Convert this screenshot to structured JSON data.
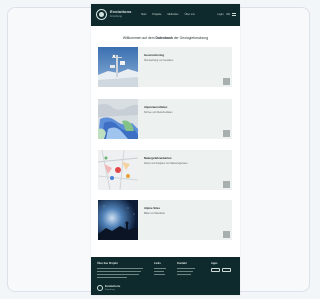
{
  "header": {
    "brand": "Evolutions",
    "brand_sub": "Forschung",
    "nav": [
      "Start",
      "Projekte",
      "Methoden",
      "Über uns"
    ],
    "nav_right": [
      "Login",
      "DE"
    ]
  },
  "headline": {
    "prefix": "Willkommen auf dem ",
    "highlight": "Datenbank",
    "suffix": " der Geologieforschung"
  },
  "items": [
    {
      "title": "Geomonitoring",
      "desc": "Überwachung von Geodaten"
    },
    {
      "title": "Alpenraum-Daten",
      "desc": "Schnee und Gletscherdaten"
    },
    {
      "title": "Naturgefahrenkarten",
      "desc": "Karten und Analysen von Naturereignissen"
    },
    {
      "title": "Alpine Sites",
      "desc": "Bilder und Standorte"
    }
  ],
  "footer": {
    "about_title": "Über das Projekt",
    "col2_title": "Links",
    "col3_title": "Kontakt",
    "col4_title": "Apps",
    "app1": "App Store",
    "app2": "Google Play",
    "brand": "Evolutions",
    "brand_sub": "Forschung"
  },
  "colors": {
    "topbar": "#0f2a2d",
    "item_bg": "#edf1ef",
    "button": "#a7b0ae"
  }
}
